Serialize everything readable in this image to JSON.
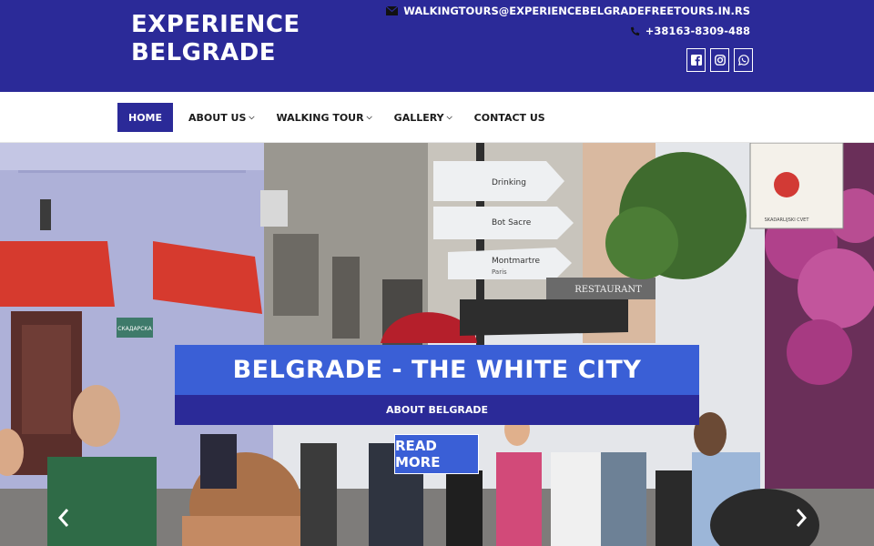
{
  "header": {
    "logo_line1": "EXPERIENCE",
    "logo_line2": "BELGRADE",
    "email": "WALKINGTOURS@EXPERIENCEBELGRADEFREETOURS.IN.RS",
    "phone": "+38163-8309-488",
    "social": [
      {
        "icon": "facebook-icon"
      },
      {
        "icon": "instagram-icon"
      },
      {
        "icon": "whatsapp-icon"
      }
    ],
    "colors": {
      "background": "#2b2a98",
      "text": "#ffffff"
    }
  },
  "nav": {
    "items": [
      {
        "label": "HOME",
        "active": true
      },
      {
        "label": "ABOUT US",
        "dropdown": true
      },
      {
        "label": "WALKING TOUR",
        "dropdown": true
      },
      {
        "label": "GALLERY",
        "dropdown": true
      },
      {
        "label": "CONTACT US"
      }
    ],
    "colors": {
      "active_bg": "#2b2a98"
    }
  },
  "hero": {
    "title": "BELGRADE - THE WHITE CITY",
    "subtitle": "ABOUT BELGRADE",
    "button": "READ MORE",
    "scene_text": {
      "sign_drinking": "Drinking",
      "sign_bot_sacre": "Bot Sacre",
      "sign_montmartre": "Montmartre",
      "sign_paris": "Paris",
      "restaurant": "RESTAURANT",
      "street_plate": "СКАДАРСКА",
      "flower_sign": "SKADARLIJSKI CVET"
    },
    "colors": {
      "title_bg": "#3a5fd6",
      "subtitle_bg": "#2b2a98"
    }
  }
}
